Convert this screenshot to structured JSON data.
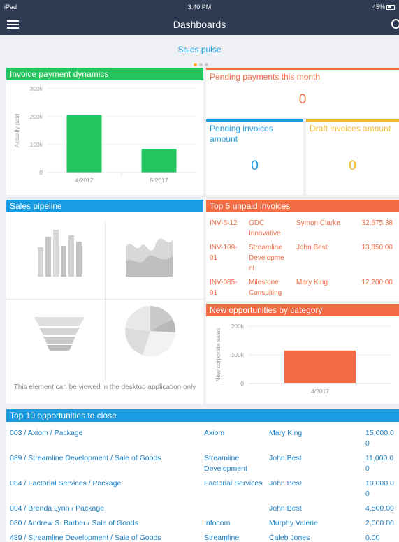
{
  "status": {
    "device": "iPad",
    "time": "3:40 PM",
    "battery": "45%"
  },
  "nav": {
    "title": "Dashboards"
  },
  "pulse": {
    "label": "Sales pulse"
  },
  "invoice_dynamics": {
    "title": "Invoice payment dynamics",
    "chart_data": {
      "type": "bar",
      "categories": [
        "4/2017",
        "5/2017"
      ],
      "values": [
        205000,
        85000
      ],
      "ylabel": "Actually paid",
      "ylim": [
        0,
        300000
      ],
      "yticks": [
        "0",
        "100k",
        "200k",
        "300k"
      ],
      "color": "#22c55e"
    }
  },
  "pending_month": {
    "title": "Pending payments this month",
    "value": "0",
    "color": "#f26c44"
  },
  "pending_invoices": {
    "title": "Pending invoices amount",
    "value": "0",
    "color": "#1b9ce2"
  },
  "draft_invoices": {
    "title": "Draft invoices amount",
    "value": "0",
    "color": "#f5b82e"
  },
  "pipeline": {
    "title": "Sales pipeline",
    "note": "This element can be viewed in the desktop application only"
  },
  "unpaid": {
    "title": "Top 5 unpaid invoices",
    "rows": [
      {
        "number": [
          "INV-5-12"
        ],
        "account": [
          "GDC",
          "Innovative"
        ],
        "contact": "Symon Clarke",
        "amount": "32,675.38"
      },
      {
        "number": [
          "INV-109-",
          "01"
        ],
        "account": [
          "Streamline",
          "Developme",
          "nt"
        ],
        "contact": "John Best",
        "amount": "13,850.00"
      },
      {
        "number": [
          "INV-085-",
          "01"
        ],
        "account": [
          "Milestone",
          "Consulting"
        ],
        "contact": "Mary King",
        "amount": "12,200.00"
      }
    ]
  },
  "new_opps": {
    "title": "New opportunities by category",
    "chart_data": {
      "type": "bar",
      "categories": [
        "4/2017"
      ],
      "values": [
        115000
      ],
      "ylabel": "New corporate sales",
      "ylim": [
        0,
        200000
      ],
      "yticks": [
        "0",
        "100k",
        "200k"
      ],
      "color": "#f26c44"
    }
  },
  "top10": {
    "title": "Top 10 opportunities to close",
    "rows": [
      {
        "name": "003 / Axiom / Package",
        "account": [
          "Axiom"
        ],
        "owner": "Mary King",
        "amount": [
          "15,000.0",
          "0"
        ]
      },
      {
        "name": "089 / Streamline Development / Sale of Goods",
        "account": [
          "Streamline",
          "Development"
        ],
        "owner": "John Best",
        "amount": [
          "11,000.0",
          "0"
        ]
      },
      {
        "name": "084 / Factorial Services / Package",
        "account": [
          "Factorial Services"
        ],
        "owner": "John Best",
        "amount": [
          "10,000.0",
          "0"
        ]
      },
      {
        "name": "004 / Brenda Lynn / Package",
        "account": [
          ""
        ],
        "owner": "John Best",
        "amount": [
          "4,500.00"
        ]
      },
      {
        "name": "080 / Andrew S. Barber / Sale of Goods",
        "account": [
          "Infocom"
        ],
        "owner": "Murphy Valerie",
        "amount": [
          "2,000.00"
        ]
      },
      {
        "name": "489 / Streamline Development / Sale of Goods",
        "account": [
          "Streamline"
        ],
        "owner": "Caleb Jones",
        "amount": [
          "0.00"
        ]
      }
    ]
  }
}
